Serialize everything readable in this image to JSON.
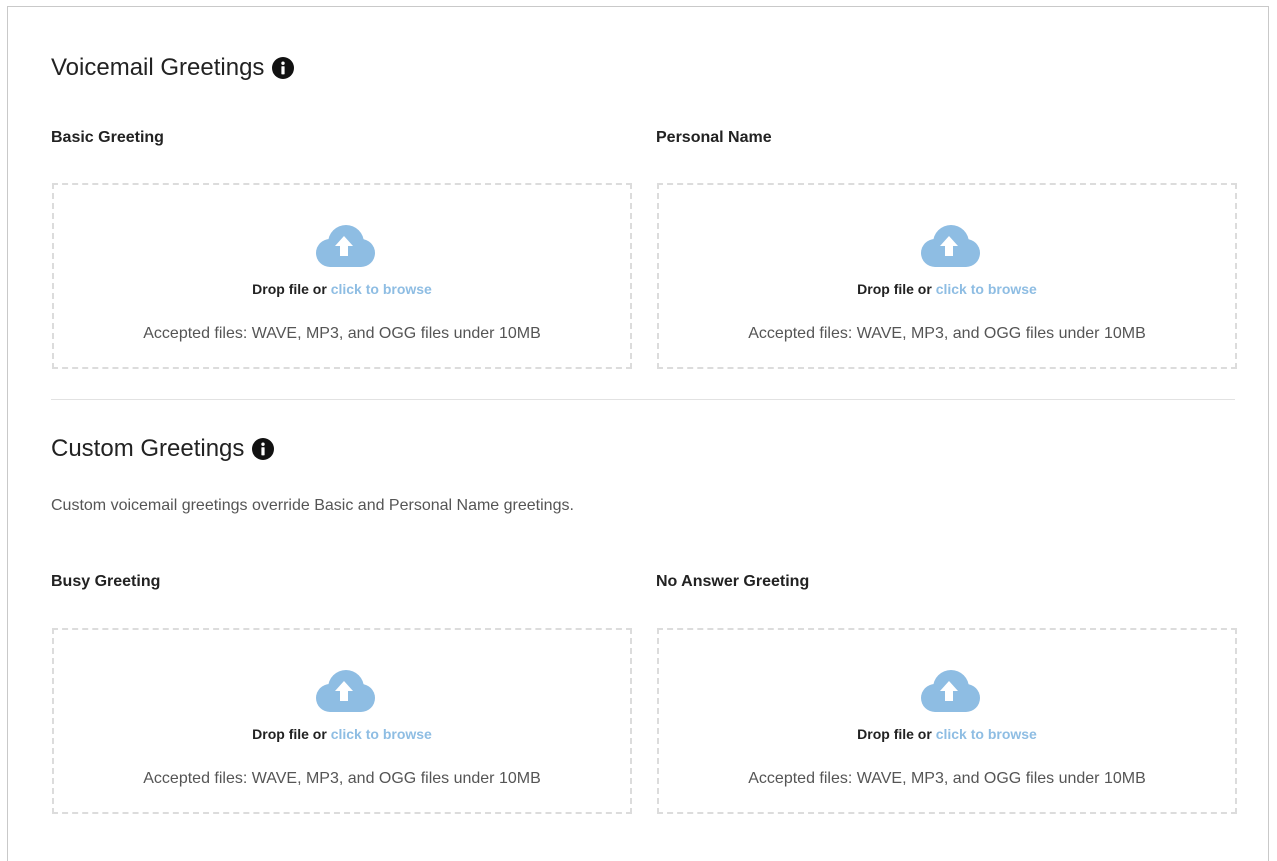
{
  "voicemail": {
    "title": "Voicemail Greetings",
    "basic": {
      "label": "Basic Greeting",
      "drop_text": "Drop file or",
      "browse_text": "click to browse",
      "accepted": "Accepted files: WAVE, MP3, and OGG files under 10MB"
    },
    "personal": {
      "label": "Personal Name",
      "drop_text": "Drop file or",
      "browse_text": "click to browse",
      "accepted": "Accepted files: WAVE, MP3, and OGG files under 10MB"
    }
  },
  "custom": {
    "title": "Custom Greetings",
    "description": "Custom voicemail greetings override Basic and Personal Name greetings.",
    "busy": {
      "label": "Busy Greeting",
      "drop_text": "Drop file or",
      "browse_text": "click to browse",
      "accepted": "Accepted files: WAVE, MP3, and OGG files under 10MB"
    },
    "no_answer": {
      "label": "No Answer Greeting",
      "drop_text": "Drop file or",
      "browse_text": "click to browse",
      "accepted": "Accepted files: WAVE, MP3, and OGG files under 10MB"
    }
  },
  "icons": {
    "info": "info-icon",
    "upload": "cloud-upload-icon"
  },
  "colors": {
    "accent": "#8ebde3",
    "text": "#222222",
    "muted": "#555555",
    "dash_border": "#dcdcdc"
  }
}
